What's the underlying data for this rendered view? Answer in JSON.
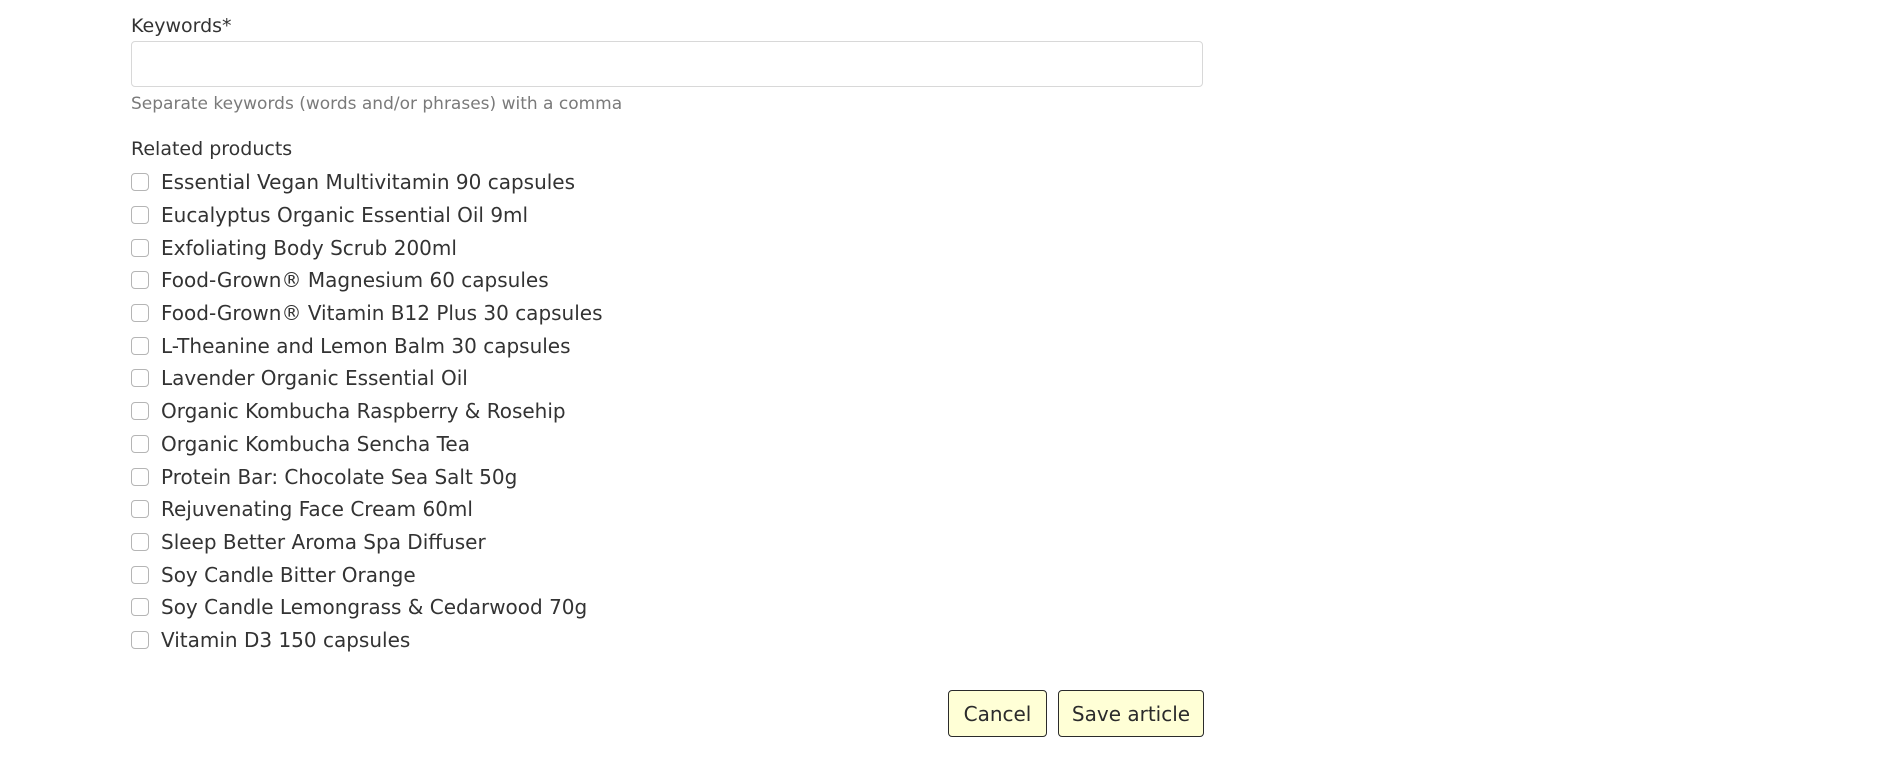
{
  "keywords": {
    "label": "Keywords*",
    "value": "",
    "placeholder": "",
    "help": "Separate keywords (words and/or phrases) with a comma"
  },
  "related_products": {
    "label": "Related products",
    "items": [
      {
        "label": "Essential Vegan Multivitamin 90 capsules",
        "checked": false
      },
      {
        "label": "Eucalyptus Organic Essential Oil 9ml",
        "checked": false
      },
      {
        "label": "Exfoliating Body Scrub 200ml",
        "checked": false
      },
      {
        "label": "Food-Grown® Magnesium 60 capsules",
        "checked": false
      },
      {
        "label": "Food-Grown® Vitamin B12 Plus 30 capsules",
        "checked": false
      },
      {
        "label": "L-Theanine and Lemon Balm 30 capsules",
        "checked": false
      },
      {
        "label": "Lavender Organic Essential Oil",
        "checked": false
      },
      {
        "label": "Organic Kombucha Raspberry & Rosehip",
        "checked": false
      },
      {
        "label": "Organic Kombucha Sencha Tea",
        "checked": false
      },
      {
        "label": "Protein Bar: Chocolate Sea Salt 50g",
        "checked": false
      },
      {
        "label": "Rejuvenating Face Cream 60ml",
        "checked": false
      },
      {
        "label": "Sleep Better Aroma Spa Diffuser",
        "checked": false
      },
      {
        "label": "Soy Candle Bitter Orange",
        "checked": false
      },
      {
        "label": "Soy Candle Lemongrass & Cedarwood 70g",
        "checked": false
      },
      {
        "label": "Vitamin D3 150 capsules",
        "checked": false
      }
    ]
  },
  "actions": {
    "cancel_label": "Cancel",
    "save_label": "Save article"
  },
  "colors": {
    "button_background": "#ffffd6",
    "button_border": "#2b2b2b",
    "help_text": "#7a7a7a",
    "input_border": "#d8d8d8"
  }
}
